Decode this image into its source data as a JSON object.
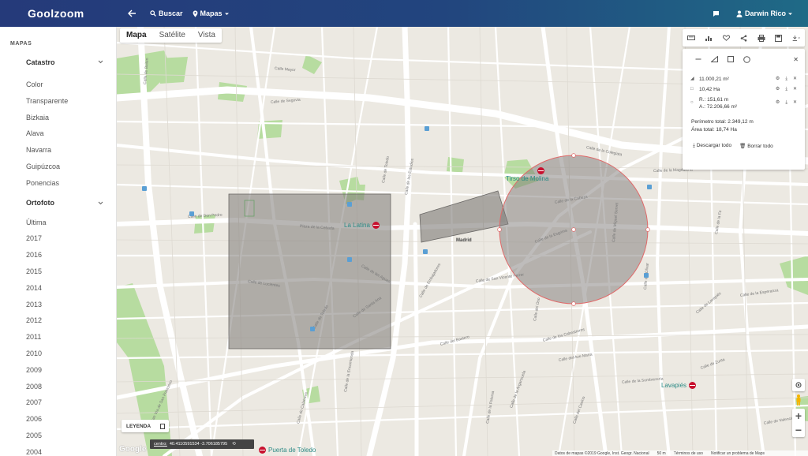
{
  "app": {
    "logo": "Goolzoom"
  },
  "header": {
    "search_label": "Buscar",
    "maps_label": "Mapas",
    "user_name": "Darwin Rico"
  },
  "sidebar": {
    "header": "MAPAS",
    "catastro": {
      "label": "Catastro",
      "items": [
        "Color",
        "Transparente",
        "Bizkaia",
        "Alava",
        "Navarra",
        "Guipúzcoa",
        "Ponencias"
      ]
    },
    "ortofoto": {
      "label": "Ortofoto",
      "items": [
        "Última",
        "2017",
        "2016",
        "2015",
        "2014",
        "2013",
        "2012",
        "2011",
        "2010",
        "2009",
        "2008",
        "2007",
        "2006",
        "2005",
        "2004"
      ]
    }
  },
  "map": {
    "tabs": [
      "Mapa",
      "Satélite",
      "Vista"
    ],
    "active_tab": "Mapa",
    "streets": [
      "Calle de Bailén",
      "Calle de Segovia",
      "Calle de la Colegiata",
      "Calle de la Cabeza",
      "Calle de Toledo",
      "Plaza de la Cebada",
      "Calle de Lucientes",
      "Calle de las Aguas",
      "Calle Mayor",
      "Calle de la Magdalena",
      "Calle de Embajadores",
      "Calle del Oso",
      "Calle de Toledo",
      "Calle de los Estudios",
      "Calle de Don Pedro",
      "Calle de San Vicente Ferrer",
      "Calle de la Esgrima",
      "Calle del Olivar",
      "Calle de Miguel Servet",
      "Calle de la Sombrerería",
      "Calle de Santa Ana",
      "Gran Vía de San Francisco",
      "Calle de los Cabestreros",
      "Calle del Ave María",
      "Calle del Bastero",
      "Calle de Calatrava",
      "Calle de la Paloma",
      "Calle de Lavapiés",
      "Calle de Zurita",
      "Calle de la Esperanza",
      "Calle de la Fe",
      "Calle de Valencia",
      "Calle de la Arganzuela",
      "Calle del Casino",
      "Calle de la Encomienda"
    ],
    "metro_stations": [
      "Tirso de Molina",
      "La Latina",
      "Lavapiés",
      "Puerta de Toledo"
    ],
    "place_label": "Madrid",
    "colors": {
      "shape_fill": "#7d7a77",
      "circle_stroke": "#e06a6a",
      "park": "#b7dca0",
      "road": "#ffffff",
      "topbar": "#253a7a"
    }
  },
  "measurements": {
    "tools": [
      "line-icon",
      "polygon-icon",
      "rectangle-icon",
      "circle-icon"
    ],
    "items": [
      {
        "shape": "polygon",
        "text": "11.000,21 m²"
      },
      {
        "shape": "rectangle",
        "text": "10,42 Ha"
      },
      {
        "shape": "circle",
        "text": "R.: 151,61 m",
        "text2": "A.: 72.206,66 m²"
      }
    ],
    "perimeter_label": "Perímetro total: 2.349,12 m",
    "area_label": "Área total: 18,74 Ha",
    "download_all": "Descargar todo",
    "delete_all": "Borrar todo"
  },
  "footer": {
    "legend": "LEYENDA",
    "center_label": "centro:",
    "center_value": "40.4110591534 -3.706185795",
    "google": "Google",
    "map_data": "Datos de mapas ©2019 Google, Inst. Geogr. Nacional",
    "scale": "50 m",
    "terms": "Términos de uso",
    "report": "Notificar un problema de Maps"
  }
}
